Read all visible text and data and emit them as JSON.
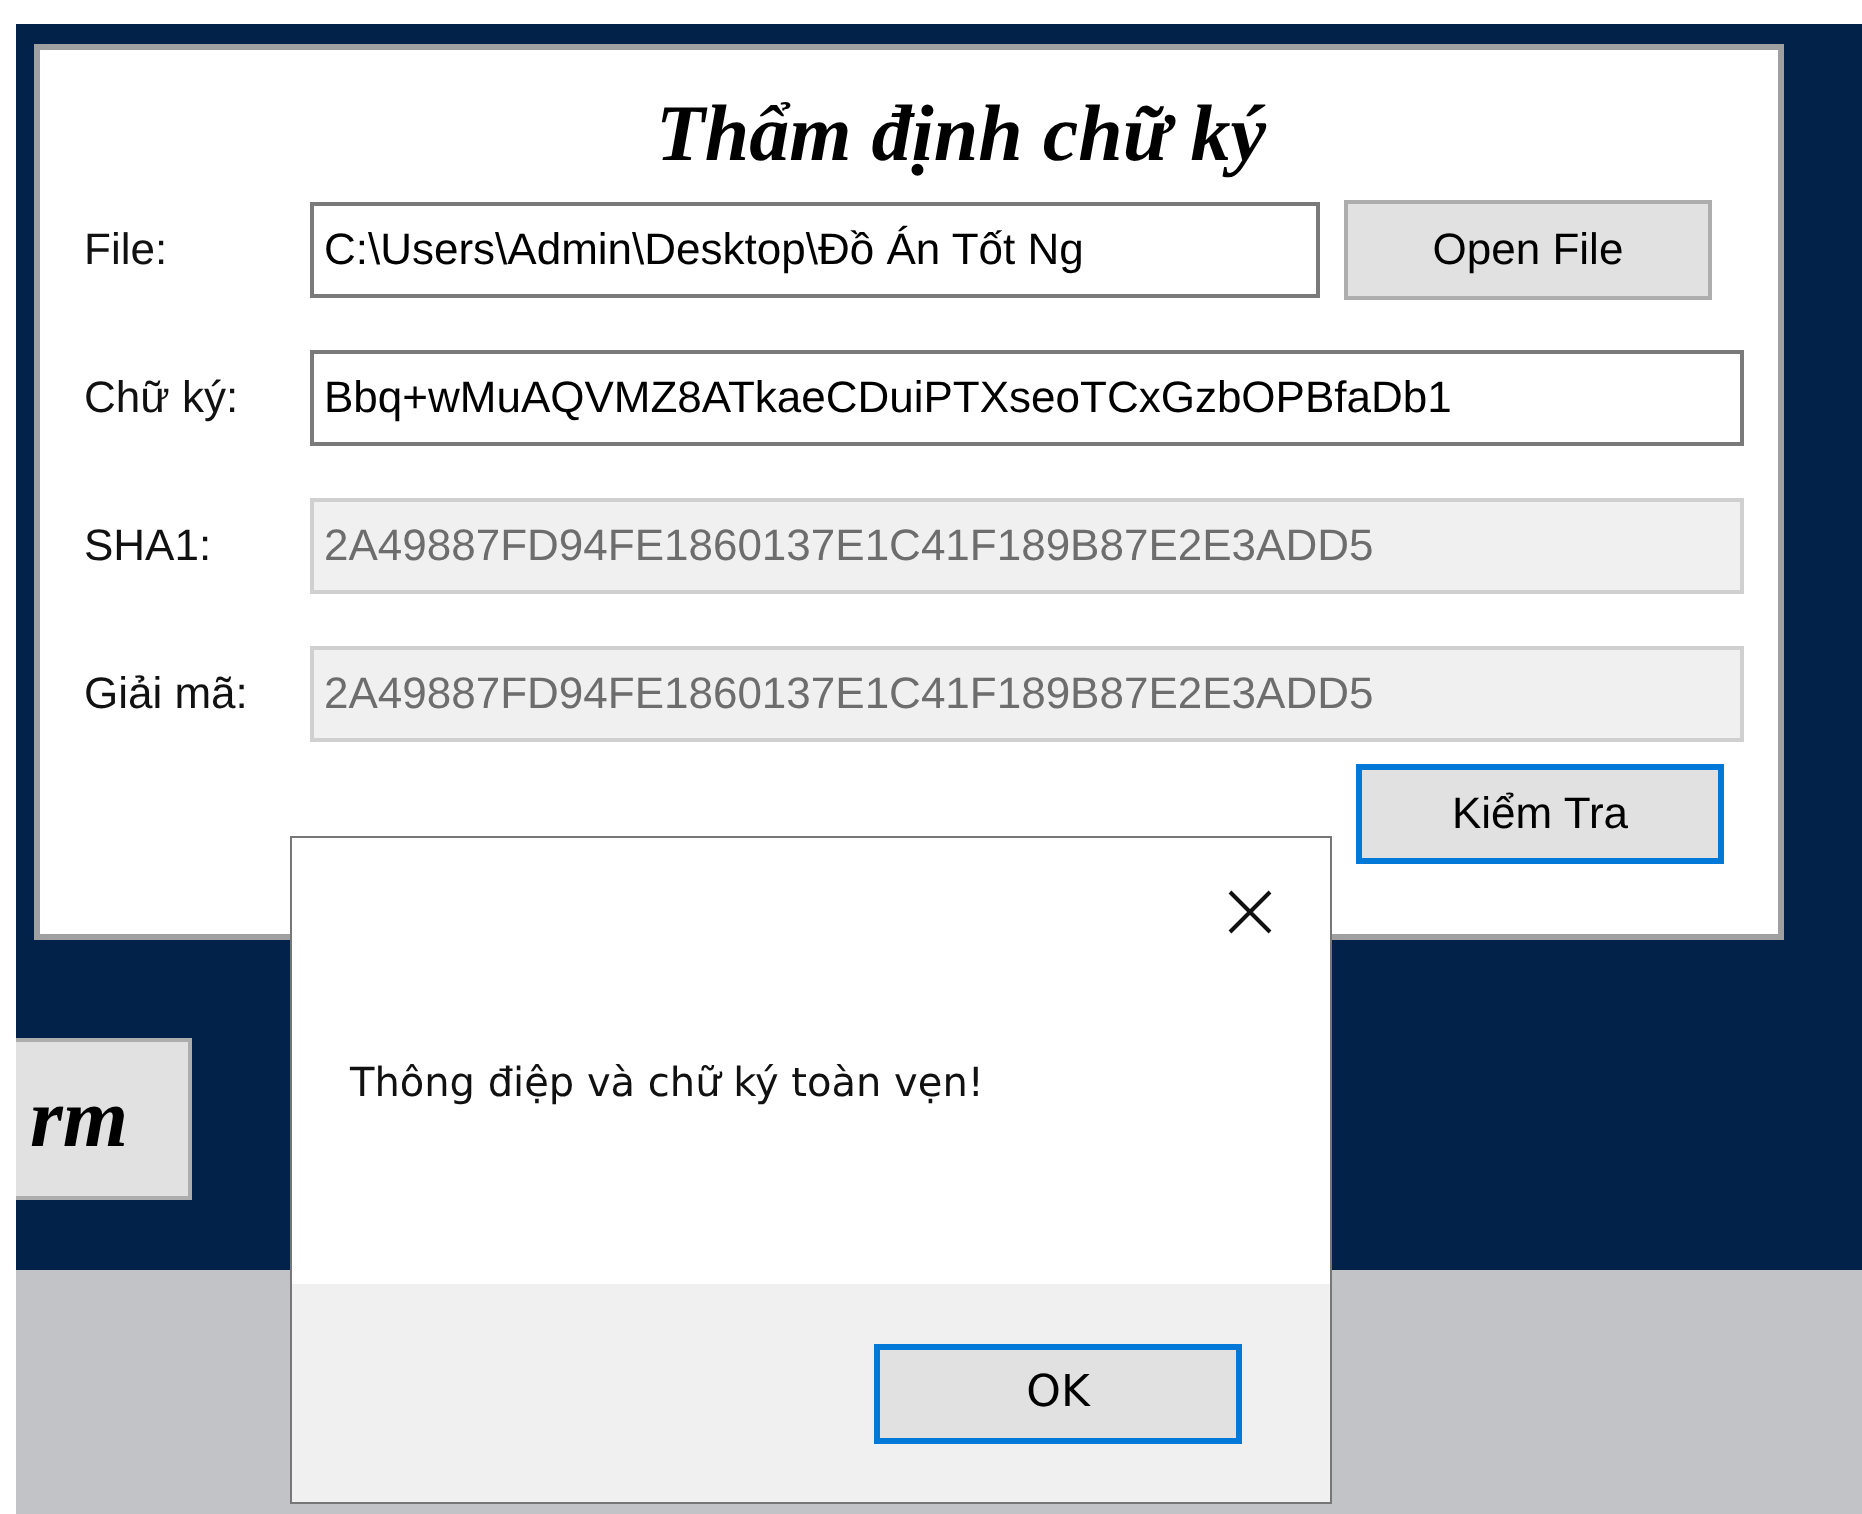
{
  "form": {
    "title": "Thẩm định chữ ký",
    "fields": [
      {
        "label": "File:",
        "value": "C:\\Users\\Admin\\Desktop\\Đồ Án Tốt Ng",
        "disabled": false,
        "kind": "file"
      },
      {
        "label": "Chữ ký:",
        "value": "Bbq+wMuAQVMZ8ATkaeCDuiPTXseoTCxGzbOPBfaDb1",
        "disabled": false,
        "kind": "text"
      },
      {
        "label": "SHA1:",
        "value": "2A49887FD94FE1860137E1C41F189B87E2E3ADD5",
        "disabled": true,
        "kind": "text"
      },
      {
        "label": "Giải mã:",
        "value": "2A49887FD94FE1860137E1C41F189B87E2E3ADD5",
        "disabled": true,
        "kind": "text"
      }
    ],
    "buttons": [
      {
        "label": "Open File",
        "focused": false
      },
      {
        "label": "Kiểm Tra",
        "focused": true
      }
    ]
  },
  "background_button": {
    "label": "rm"
  },
  "dialog": {
    "message": "Thông điệp và chữ ký toàn vẹn!",
    "buttons": [
      {
        "label": "OK",
        "focused": true
      }
    ]
  }
}
